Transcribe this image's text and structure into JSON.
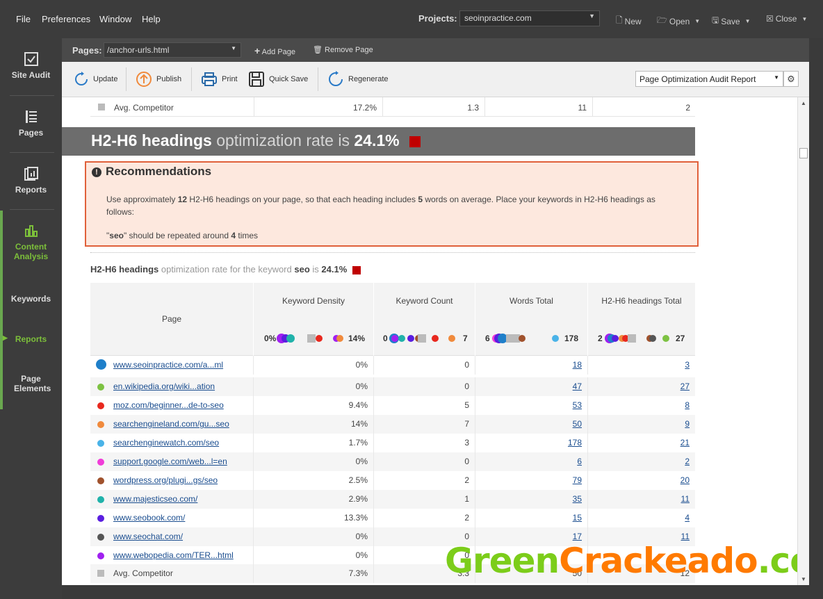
{
  "menu": {
    "file": "File",
    "preferences": "Preferences",
    "window": "Window",
    "help": "Help"
  },
  "projects": {
    "label": "Projects:",
    "value": "seoinpractice.com"
  },
  "top_buttons": {
    "new": "New",
    "open": "Open",
    "save": "Save",
    "close": "Close"
  },
  "sidebar": {
    "items": [
      {
        "label": "Site Audit"
      },
      {
        "label": "Pages"
      },
      {
        "label": "Reports"
      },
      {
        "label": "Content Analysis"
      },
      {
        "label": "Keywords"
      },
      {
        "label": "Reports"
      },
      {
        "label": "Page Elements"
      }
    ]
  },
  "pages_bar": {
    "label": "Pages:",
    "value": "/anchor-urls.html",
    "add": "Add Page",
    "remove": "Remove Page"
  },
  "toolbar": {
    "update": "Update",
    "publish": "Publish",
    "print": "Print",
    "quick_save": "Quick Save",
    "regenerate": "Regenerate",
    "report": "Page Optimization Audit Report"
  },
  "avg_top": {
    "label": "Avg. Competitor",
    "density": "17.2%",
    "count": "1.3",
    "words": "11",
    "headings": "2"
  },
  "section": {
    "title_bold": "H2-H6 headings",
    "title_light": "optimization rate is",
    "rate": "24.1%"
  },
  "recommendations": {
    "title": "Recommendations",
    "p1_a": "Use approximately",
    "p1_n1": "12",
    "p1_b": "H2-H6 headings on your page, so that each heading includes",
    "p1_n2": "5",
    "p1_c": "words on average. Place your keywords in H2-H6 headings as follows:",
    "p2_q1": "\"",
    "p2_kw": "seo",
    "p2_a": "\" should be repeated around",
    "p2_n": "4",
    "p2_b": "times"
  },
  "subsection": {
    "bold": "H2-H6 headings",
    "light": "optimization rate for the keyword",
    "kw": "seo",
    "is": "is",
    "rate": "24.1%"
  },
  "table": {
    "headers": {
      "page": "Page",
      "density": "Keyword Density",
      "count": "Keyword Count",
      "words": "Words Total",
      "headings": "H2-H6 headings Total"
    },
    "ranges": {
      "density_min": "0%",
      "density_max": "14%",
      "count_min": "0",
      "count_max": "7",
      "words_min": "6",
      "words_max": "178",
      "headings_min": "2",
      "headings_max": "27"
    },
    "rows": [
      {
        "url": "www.seoinpractice.com/a...ml",
        "density": "0%",
        "count": "0",
        "words": "18",
        "headings": "3",
        "color": "#1f7fc9"
      },
      {
        "url": "en.wikipedia.org/wiki...ation",
        "density": "0%",
        "count": "0",
        "words": "47",
        "headings": "27",
        "color": "#7dc242"
      },
      {
        "url": "moz.com/beginner...de-to-seo",
        "density": "9.4%",
        "count": "5",
        "words": "53",
        "headings": "8",
        "color": "#e8281e"
      },
      {
        "url": "searchengineland.com/gu...seo",
        "density": "14%",
        "count": "7",
        "words": "50",
        "headings": "9",
        "color": "#f08a3c"
      },
      {
        "url": "searchenginewatch.com/seo",
        "density": "1.7%",
        "count": "3",
        "words": "178",
        "headings": "21",
        "color": "#4ab3e8"
      },
      {
        "url": "support.google.com/web...l=en",
        "density": "0%",
        "count": "0",
        "words": "6",
        "headings": "2",
        "color": "#f03cd8"
      },
      {
        "url": "wordpress.org/plugi...gs/seo",
        "density": "2.5%",
        "count": "2",
        "words": "79",
        "headings": "20",
        "color": "#a0522d"
      },
      {
        "url": "www.majesticseo.com/",
        "density": "2.9%",
        "count": "1",
        "words": "35",
        "headings": "11",
        "color": "#20b2aa"
      },
      {
        "url": "www.seobook.com/",
        "density": "13.3%",
        "count": "2",
        "words": "15",
        "headings": "4",
        "color": "#5a1ee0"
      },
      {
        "url": "www.seochat.com/",
        "density": "0%",
        "count": "0",
        "words": "17",
        "headings": "11",
        "color": "#555555"
      },
      {
        "url": "www.webopedia.com/TER...html",
        "density": "0%",
        "count": "0",
        "words": "",
        "headings": "",
        "color": "#a020f0"
      }
    ],
    "avg": {
      "label": "Avg. Competitor",
      "density": "7.3%",
      "count": "3.3",
      "words": "50",
      "headings": "12"
    }
  },
  "watermark": {
    "green": "Green",
    "orange": "Crackeado",
    "green2": ".com"
  }
}
